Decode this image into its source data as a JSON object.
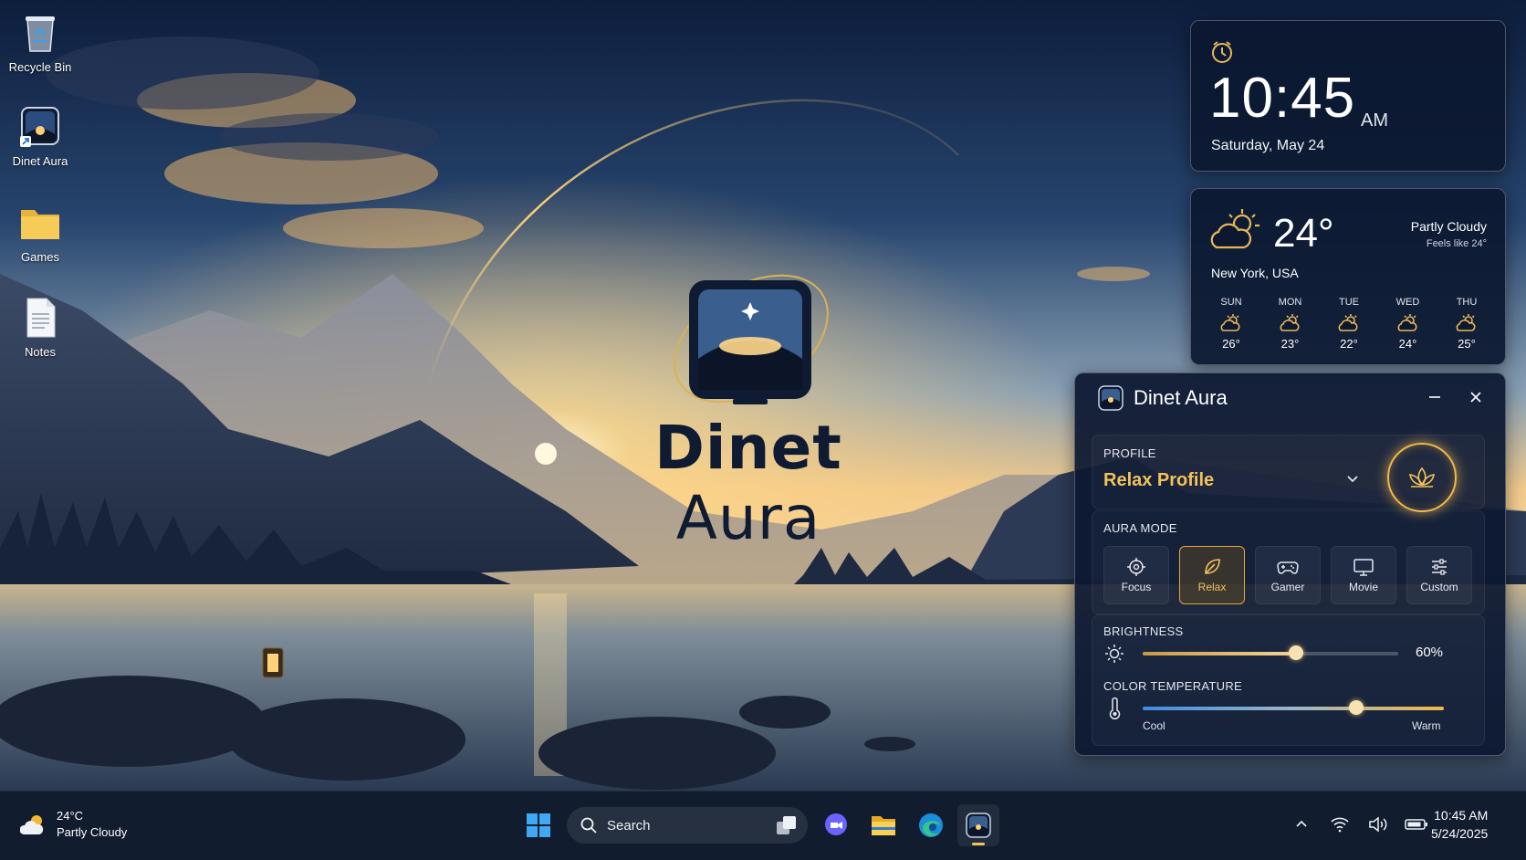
{
  "desktop": {
    "icons": [
      {
        "label": "Recycle Bin",
        "icon": "recycle-bin-icon"
      },
      {
        "label": "Dinet Aura",
        "icon": "dinet-aura-app-icon"
      },
      {
        "label": "Games",
        "icon": "folder-icon"
      },
      {
        "label": "Notes",
        "icon": "text-document-icon"
      }
    ],
    "logo": {
      "word1": "Dinet",
      "word2": "Aura"
    }
  },
  "clock_widget": {
    "time": "10:45",
    "ampm": "AM",
    "date": "Saturday, May 24",
    "icon": "alarm-clock-icon"
  },
  "weather_widget": {
    "temperature": "24°",
    "condition": "Partly Cloudy",
    "feels_like": "Feels like 24°",
    "location": "New York, USA",
    "icon": "partly-cloudy-icon",
    "forecast": [
      {
        "day": "SUN",
        "temp": "26°"
      },
      {
        "day": "MON",
        "temp": "23°"
      },
      {
        "day": "TUE",
        "temp": "22°"
      },
      {
        "day": "WED",
        "temp": "24°"
      },
      {
        "day": "THU",
        "temp": "25°"
      }
    ]
  },
  "app": {
    "title": "Dinet Aura",
    "profile": {
      "label": "PROFILE",
      "value": "Relax Profile",
      "icon": "lotus-icon"
    },
    "aura_mode": {
      "label": "AURA MODE",
      "selected": "Relax",
      "modes": [
        {
          "label": "Focus",
          "icon": "focus-target-icon"
        },
        {
          "label": "Relax",
          "icon": "leaf-icon"
        },
        {
          "label": "Gamer",
          "icon": "gamepad-icon"
        },
        {
          "label": "Movie",
          "icon": "monitor-icon"
        },
        {
          "label": "Custom",
          "icon": "sliders-icon"
        }
      ]
    },
    "brightness": {
      "label": "BRIGHTNESS",
      "value": 60,
      "display": "60%"
    },
    "color_temperature": {
      "label": "COLOR TEMPERATURE",
      "value": 0.71,
      "min_label": "Cool",
      "max_label": "Warm"
    }
  },
  "taskbar": {
    "weather": {
      "temp": "24°C",
      "condition": "Partly Cloudy"
    },
    "search_placeholder": "Search",
    "clock": {
      "time": "10:45 AM",
      "date": "5/24/2025"
    },
    "accent": "#f2c35a"
  }
}
